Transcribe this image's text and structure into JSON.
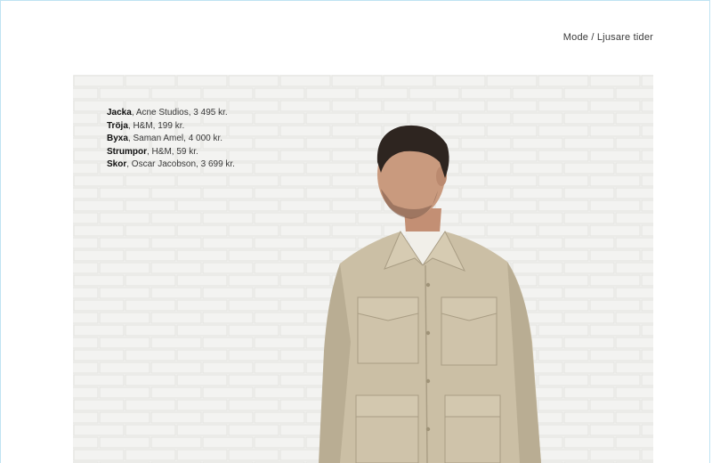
{
  "header": {
    "running_head": "Mode / Ljusare tider"
  },
  "photo": {
    "subject": "man-in-beige-overshirt-photo",
    "credits": [
      {
        "item": "Jacka",
        "detail": ", Acne Studios, 3 495 kr."
      },
      {
        "item": "Tröja",
        "detail": ", H&M, 199 kr."
      },
      {
        "item": "Byxa",
        "detail": ", Saman Amel, 4 000 kr."
      },
      {
        "item": "Strumpor",
        "detail": ", H&M, 59 kr."
      },
      {
        "item": "Skor",
        "detail": ", Oscar Jacobson, 3 699 kr."
      }
    ]
  },
  "colors": {
    "wall": "#f3f3f1",
    "mortar": "#e3e3e0",
    "jacket": "#cbbfa5",
    "hair": "#2e2520",
    "skin": "#c99a7e"
  }
}
